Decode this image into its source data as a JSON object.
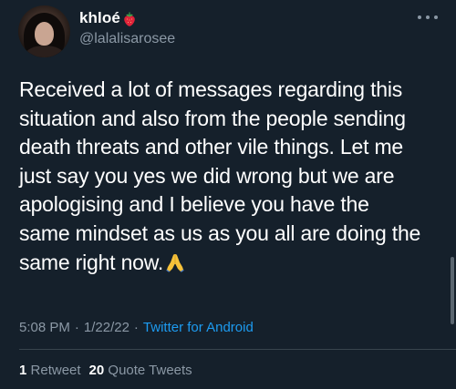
{
  "user": {
    "display_name": "khloé",
    "handle": "@lalalisarosee",
    "name_emoji_icon": "strawberry-icon"
  },
  "tweet": {
    "lines": [
      "Received a lot of messages regarding this",
      "situation and also from the people sending",
      "death threats and other vile things. Let me",
      "just say you yes we did wrong but we are",
      "apologising and I believe you have the",
      "same mindset as us as you all are doing the",
      "same right now."
    ],
    "trailing_emoji_icon": "folded-hands-icon"
  },
  "meta": {
    "time": "5:08 PM",
    "date": "1/22/22",
    "separator": "·",
    "source": "Twitter for Android"
  },
  "stats": {
    "retweets_count": "1",
    "retweets_label": "Retweet",
    "quotes_count": "20",
    "quotes_label": "Quote Tweets"
  },
  "colors": {
    "background": "#15202b",
    "text": "#ffffff",
    "secondary": "#8b98a5",
    "link": "#1d9bf0"
  }
}
